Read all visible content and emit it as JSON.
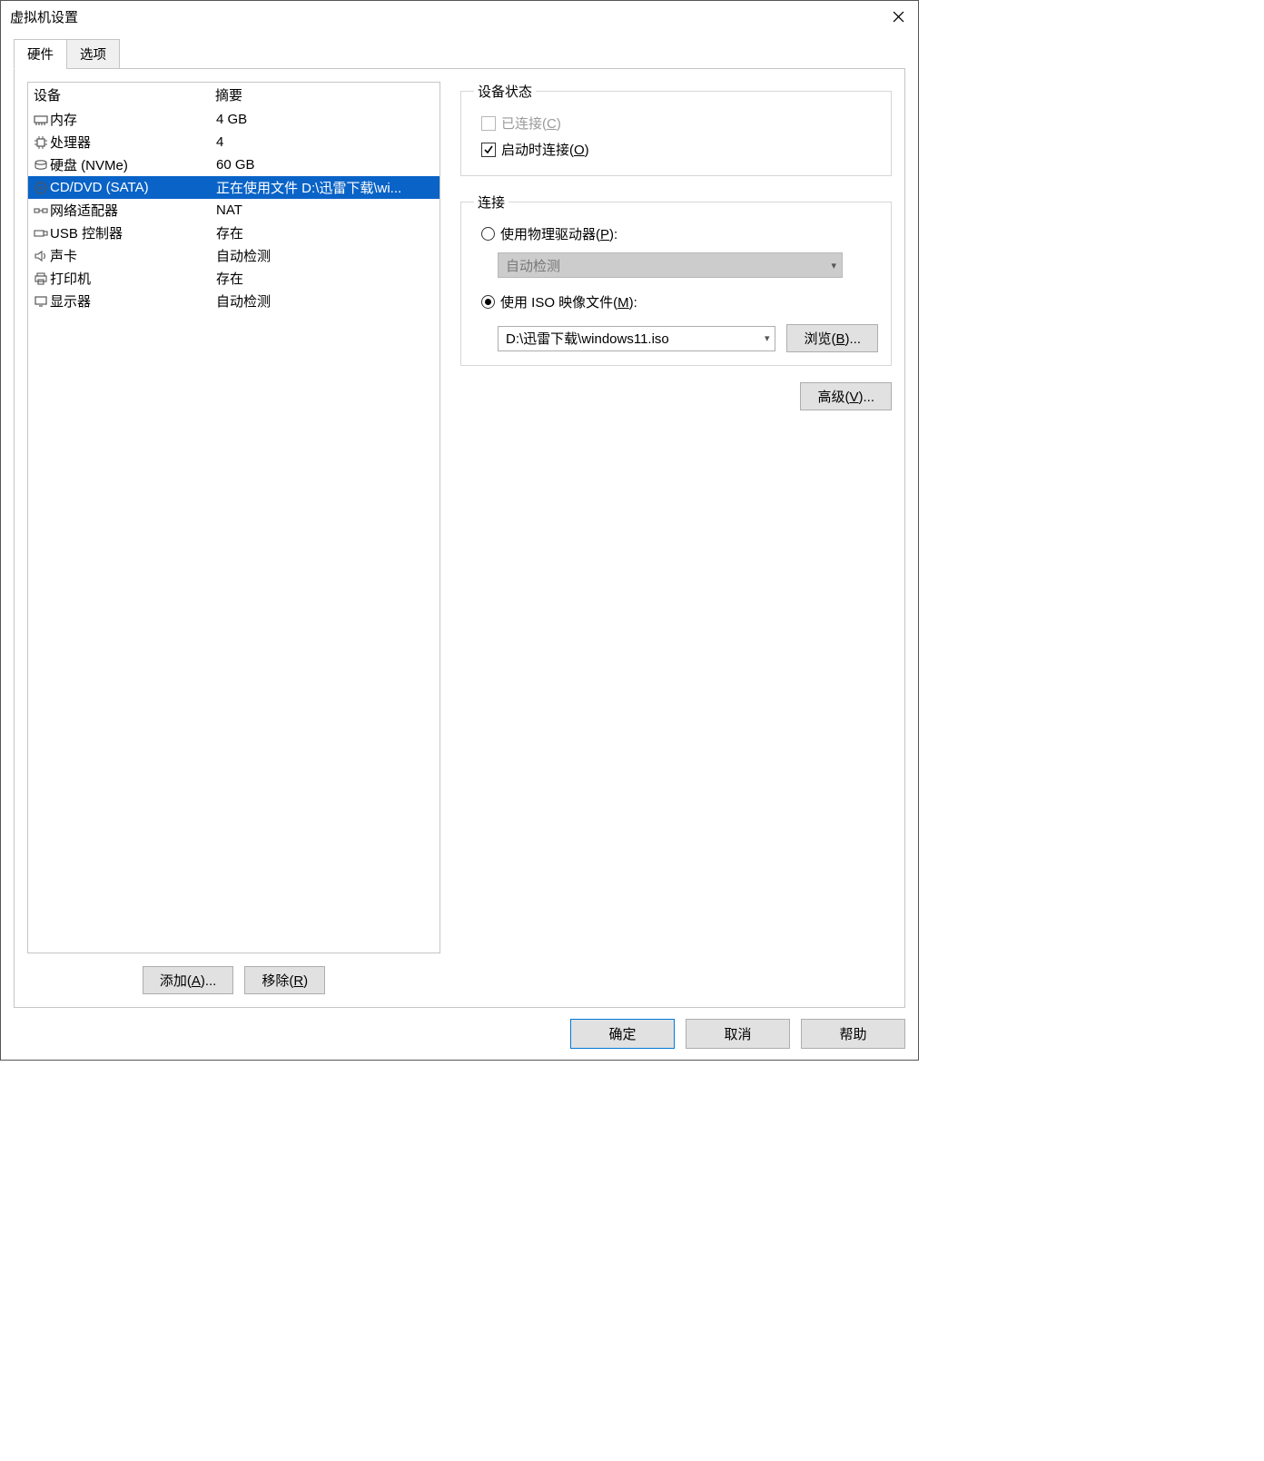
{
  "window": {
    "title": "虚拟机设置"
  },
  "tabs": {
    "hardware": "硬件",
    "options": "选项"
  },
  "device_list": {
    "header_device": "设备",
    "header_summary": "摘要",
    "rows": [
      {
        "icon": "memory-icon",
        "name": "内存",
        "summary": "4 GB",
        "selected": false
      },
      {
        "icon": "cpu-icon",
        "name": "处理器",
        "summary": "4",
        "selected": false
      },
      {
        "icon": "disk-icon",
        "name": "硬盘 (NVMe)",
        "summary": "60 GB",
        "selected": false
      },
      {
        "icon": "cddvd-icon",
        "name": "CD/DVD (SATA)",
        "summary": "正在使用文件 D:\\迅雷下载\\wi...",
        "selected": true
      },
      {
        "icon": "network-icon",
        "name": "网络适配器",
        "summary": "NAT",
        "selected": false
      },
      {
        "icon": "usb-icon",
        "name": "USB 控制器",
        "summary": "存在",
        "selected": false
      },
      {
        "icon": "sound-icon",
        "name": "声卡",
        "summary": "自动检测",
        "selected": false
      },
      {
        "icon": "printer-icon",
        "name": "打印机",
        "summary": "存在",
        "selected": false
      },
      {
        "icon": "display-icon",
        "name": "显示器",
        "summary": "自动检测",
        "selected": false
      }
    ]
  },
  "left_buttons": {
    "add_prefix": "添加(",
    "add_key": "A",
    "add_suffix": ")...",
    "remove_prefix": "移除(",
    "remove_key": "R",
    "remove_suffix": ")"
  },
  "status_group": {
    "legend": "设备状态",
    "connected_prefix": "已连接(",
    "connected_key": "C",
    "connected_suffix": ")",
    "connected_checked": false,
    "connected_enabled": false,
    "connect_at_power_prefix": "启动时连接(",
    "connect_at_power_key": "O",
    "connect_at_power_suffix": ")",
    "connect_at_power_checked": true
  },
  "connection_group": {
    "legend": "连接",
    "physical_prefix": "使用物理驱动器(",
    "physical_key": "P",
    "physical_suffix": "):",
    "physical_selected": false,
    "physical_drive_value": "自动检测",
    "iso_prefix": "使用 ISO 映像文件(",
    "iso_key": "M",
    "iso_suffix": "):",
    "iso_selected": true,
    "iso_path": "D:\\迅雷下载\\windows11.iso",
    "browse_prefix": "浏览(",
    "browse_key": "B",
    "browse_suffix": ")..."
  },
  "advanced_btn": {
    "prefix": "高级(",
    "key": "V",
    "suffix": ")..."
  },
  "footer": {
    "ok": "确定",
    "cancel": "取消",
    "help": "帮助"
  }
}
